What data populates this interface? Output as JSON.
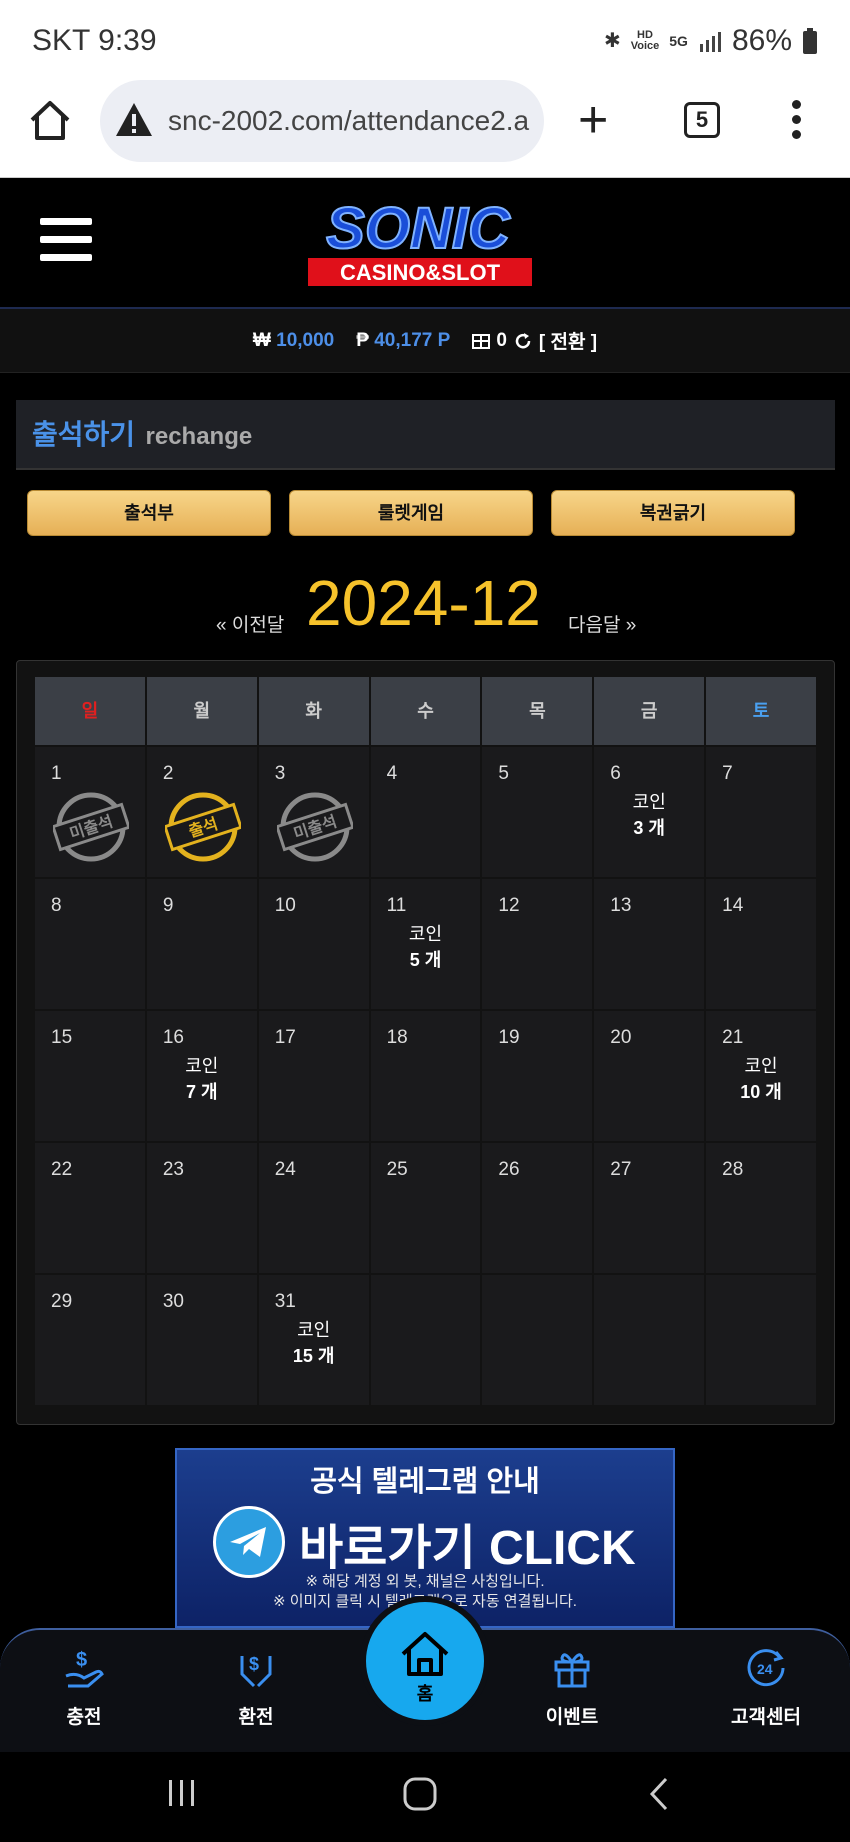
{
  "status": {
    "carrier_time": "SKT 9:39",
    "battery": "86%",
    "hd_label": "HD",
    "voice_label": "Voice",
    "network": "5G"
  },
  "browser": {
    "url": "snc-2002.com/attendance2.a",
    "tab_count": "5"
  },
  "logo": {
    "brand": "SONIC",
    "sub": "CASINO&SLOT"
  },
  "account": {
    "won_symbol": "₩",
    "money": "10,000",
    "point_symbol": "₱",
    "points": "40,177 P",
    "coin_count": "0",
    "convert": "[ 전환 ]"
  },
  "page": {
    "title_ko": "출석하기",
    "title_en": "rechange"
  },
  "buttons": {
    "attendance": "출석부",
    "roulette": "룰렛게임",
    "lottery": "복권긁기"
  },
  "calendar": {
    "prev": "« 이전달",
    "month": "2024-12",
    "next": "다음달 »",
    "weekdays": [
      "일",
      "월",
      "화",
      "수",
      "목",
      "금",
      "토"
    ],
    "coin_label": "코인",
    "stamp_absent": "미출석",
    "stamp_present": "출석",
    "weeks": [
      [
        {
          "d": "1",
          "stamp": "absent"
        },
        {
          "d": "2",
          "stamp": "present"
        },
        {
          "d": "3",
          "stamp": "absent"
        },
        {
          "d": "4"
        },
        {
          "d": "5"
        },
        {
          "d": "6",
          "coin": "3 개"
        },
        {
          "d": "7"
        }
      ],
      [
        {
          "d": "8"
        },
        {
          "d": "9"
        },
        {
          "d": "10"
        },
        {
          "d": "11",
          "coin": "5 개"
        },
        {
          "d": "12"
        },
        {
          "d": "13"
        },
        {
          "d": "14"
        }
      ],
      [
        {
          "d": "15"
        },
        {
          "d": "16",
          "coin": "7 개"
        },
        {
          "d": "17"
        },
        {
          "d": "18"
        },
        {
          "d": "19"
        },
        {
          "d": "20"
        },
        {
          "d": "21",
          "coin": "10 개"
        }
      ],
      [
        {
          "d": "22"
        },
        {
          "d": "23"
        },
        {
          "d": "24"
        },
        {
          "d": "25"
        },
        {
          "d": "26"
        },
        {
          "d": "27"
        },
        {
          "d": "28"
        }
      ],
      [
        {
          "d": "29"
        },
        {
          "d": "30"
        },
        {
          "d": "31",
          "coin": "15 개"
        },
        {
          "d": ""
        },
        {
          "d": ""
        },
        {
          "d": ""
        },
        {
          "d": ""
        }
      ]
    ]
  },
  "banner": {
    "title": "공식 텔레그램 안내",
    "cta": "바로가기 CLICK",
    "note1": "※ 해당 계정 외 봇, 채널은 사칭입니다.",
    "note2": "※ 이미지 클릭 시 텔레그램으로 자동 연결됩니다."
  },
  "nav": {
    "charge": "충전",
    "exchange": "환전",
    "home": "홈",
    "event": "이벤트",
    "support": "고객센터"
  },
  "colors": {
    "accent_blue": "#17a8ee",
    "gold": "#f6c22b",
    "sunday": "#e02020",
    "saturday": "#4aa0f0"
  }
}
